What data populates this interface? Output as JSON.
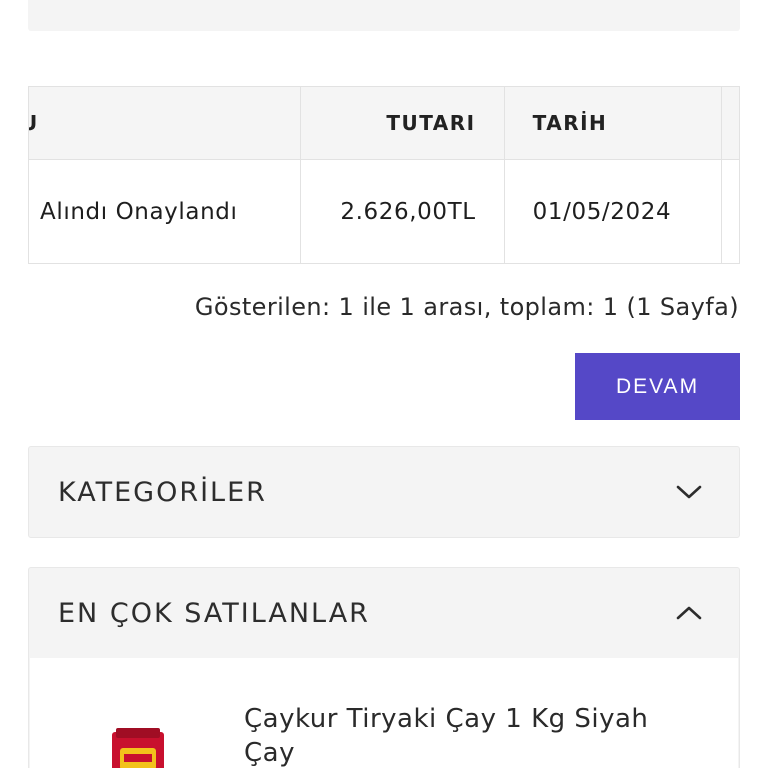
{
  "orders_table": {
    "headers": {
      "status_fragment": "U",
      "amount": "TUTARI",
      "date": "TARİH"
    },
    "rows": [
      {
        "status": "Alındı Onaylandı",
        "amount": "2.626,00TL",
        "date": "01/05/2024"
      }
    ]
  },
  "pagination": {
    "info": "Gösterilen: 1 ile 1 arası, toplam: 1 (1 Sayfa)"
  },
  "continue_button": {
    "label": "DEVAM",
    "color": "#5548c7"
  },
  "categories_panel": {
    "title": "KATEGORİLER",
    "icon": "chevron-down-icon"
  },
  "bestsellers_panel": {
    "title": "EN ÇOK SATILANLAR",
    "icon": "chevron-up-icon",
    "items": [
      {
        "name": "Çaykur Tiryaki Çay 1 Kg Siyah Çay",
        "image_icon": "tea-package-thumbnail"
      }
    ]
  }
}
